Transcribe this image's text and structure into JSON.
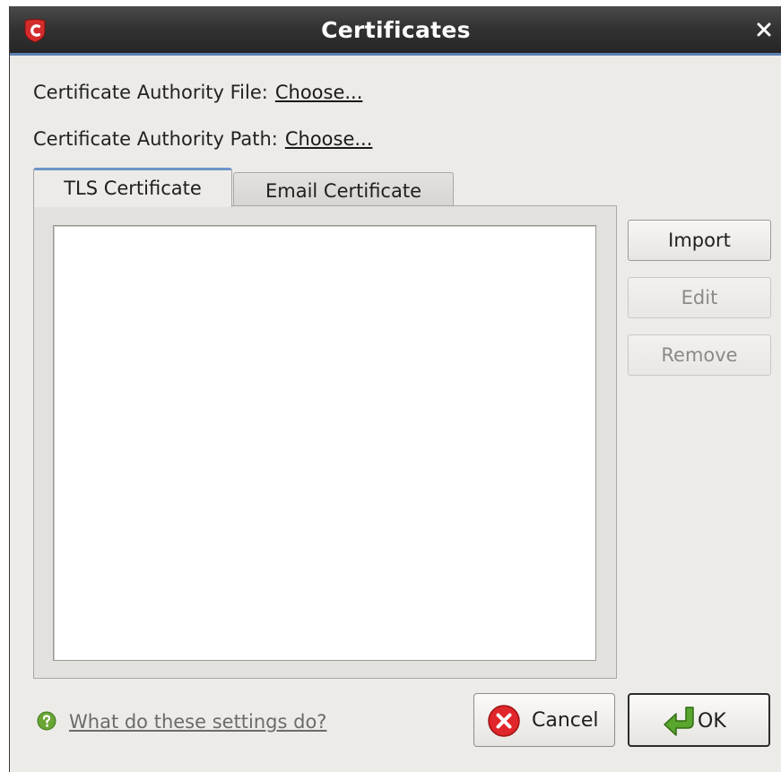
{
  "window": {
    "title": "Certificates",
    "logo_icon": "comodo-shield-icon",
    "close_icon": "close-icon"
  },
  "ca_file": {
    "label": "Certificate Authority File:",
    "action": "Choose..."
  },
  "ca_path": {
    "label": "Certificate Authority Path:",
    "action": "Choose..."
  },
  "tabs": [
    {
      "label": "TLS Certificate",
      "active": true
    },
    {
      "label": "Email Certificate",
      "active": false
    }
  ],
  "side_buttons": {
    "import": "Import",
    "edit": "Edit",
    "remove": "Remove"
  },
  "footer": {
    "help_text": "What do these settings do?",
    "cancel": "Cancel",
    "ok": "OK"
  },
  "colors": {
    "titlebar": "#333333",
    "titlebar_accent": "#5b7fb3",
    "logo_red": "#d42b2b",
    "cancel_red": "#e0262a",
    "ok_green": "#5aa52d",
    "help_green": "#6aa535"
  }
}
